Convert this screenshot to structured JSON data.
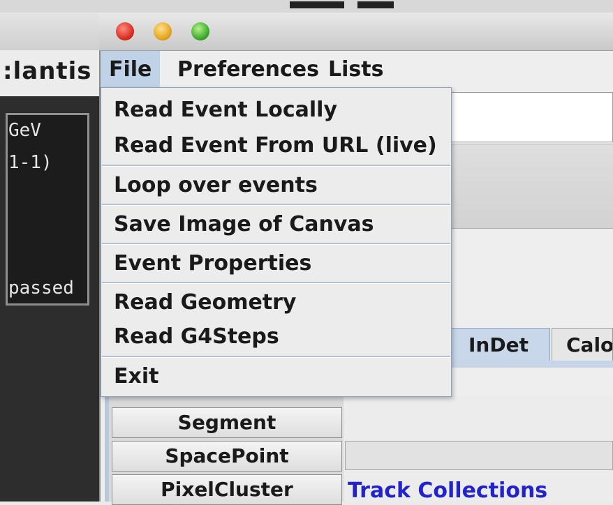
{
  "background_window": {
    "title": "Atlantis",
    "title_visible": ":lantis",
    "lines": [
      "GeV",
      "1-1)",
      "passed"
    ]
  },
  "window": {
    "menu": [
      "File",
      "Preferences",
      "Lists"
    ]
  },
  "file_menu": {
    "items": [
      "Read Event Locally",
      "Read Event From URL (live)",
      "Loop over events",
      "Save Image of Canvas",
      "Event Properties",
      "Read Geometry",
      "Read G4Steps",
      "Exit"
    ]
  },
  "tabs": [
    "InDet",
    "Calo"
  ],
  "list_buttons": [
    "Segment",
    "SpacePoint",
    "PixelCluster"
  ],
  "track_collections_label": "Track Collections",
  "colors": {
    "menu_highlight": "#bfd2e6",
    "link_blue": "#2323cc",
    "dark_panel": "#2d2d2d"
  }
}
